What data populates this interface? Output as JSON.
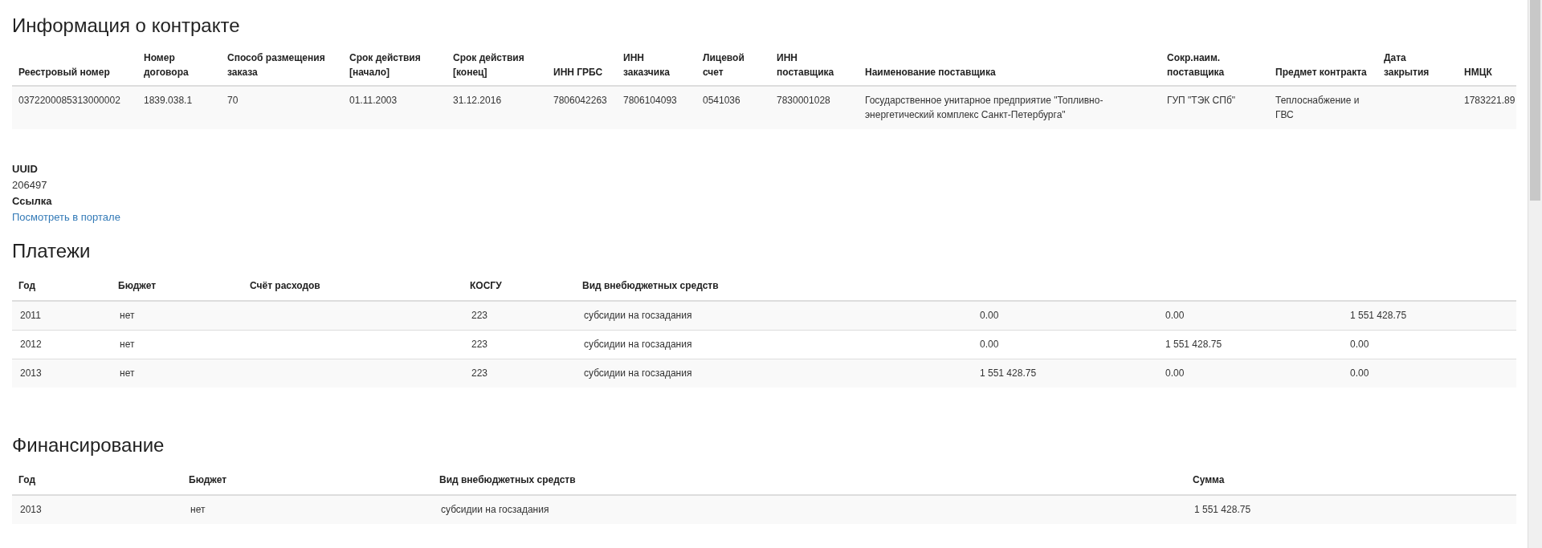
{
  "contract": {
    "title": "Информация о контракте",
    "columns": [
      "Реестровый номер",
      "Номер договора",
      "Способ размещения заказа",
      "Срок действия [начало]",
      "Срок действия [конец]",
      "ИНН ГРБС",
      "ИНН заказчика",
      "Лицевой счет",
      "ИНН поставщика",
      "Наименование поставщика",
      "Сокр.наим. поставщика",
      "Предмет контракта",
      "Дата закрытия",
      "НМЦК"
    ],
    "rows": [
      [
        "0372200085313000002",
        "1839.038.1",
        "70",
        "01.11.2003",
        "31.12.2016",
        "7806042263",
        "7806104093",
        "0541036",
        "7830001028",
        "Государственное унитарное предприятие \"Топливно-энергетический комплекс Санкт-Петербурга\"",
        "ГУП \"ТЭК СПб\"",
        "Теплоснабжение и ГВС",
        "",
        "1783221.89"
      ]
    ]
  },
  "details": [
    {
      "label": "UUID",
      "value": "206497",
      "kind": "text"
    },
    {
      "label": "Ссылка",
      "value": "Посмотреть в портале",
      "kind": "link"
    }
  ],
  "payments": {
    "title": "Платежи",
    "columns": [
      "Год",
      "Бюджет",
      "Счёт расходов",
      "КОСГУ",
      "Вид внебюджетных средств",
      "",
      "",
      ""
    ],
    "rows": [
      [
        "2011",
        "нет",
        "",
        "223",
        "субсидии на госзадания",
        "0.00",
        "0.00",
        "1 551 428.75"
      ],
      [
        "2012",
        "нет",
        "",
        "223",
        "субсидии на госзадания",
        "0.00",
        "1 551 428.75",
        "0.00"
      ],
      [
        "2013",
        "нет",
        "",
        "223",
        "субсидии на госзадания",
        "1 551 428.75",
        "0.00",
        "0.00"
      ]
    ]
  },
  "financing": {
    "title": "Финансирование",
    "columns": [
      "Год",
      "Бюджет",
      "Вид внебюджетных средств",
      "Сумма"
    ],
    "rows": [
      [
        "2013",
        "нет",
        "субсидии на госзадания",
        "1 551 428.75"
      ]
    ]
  }
}
